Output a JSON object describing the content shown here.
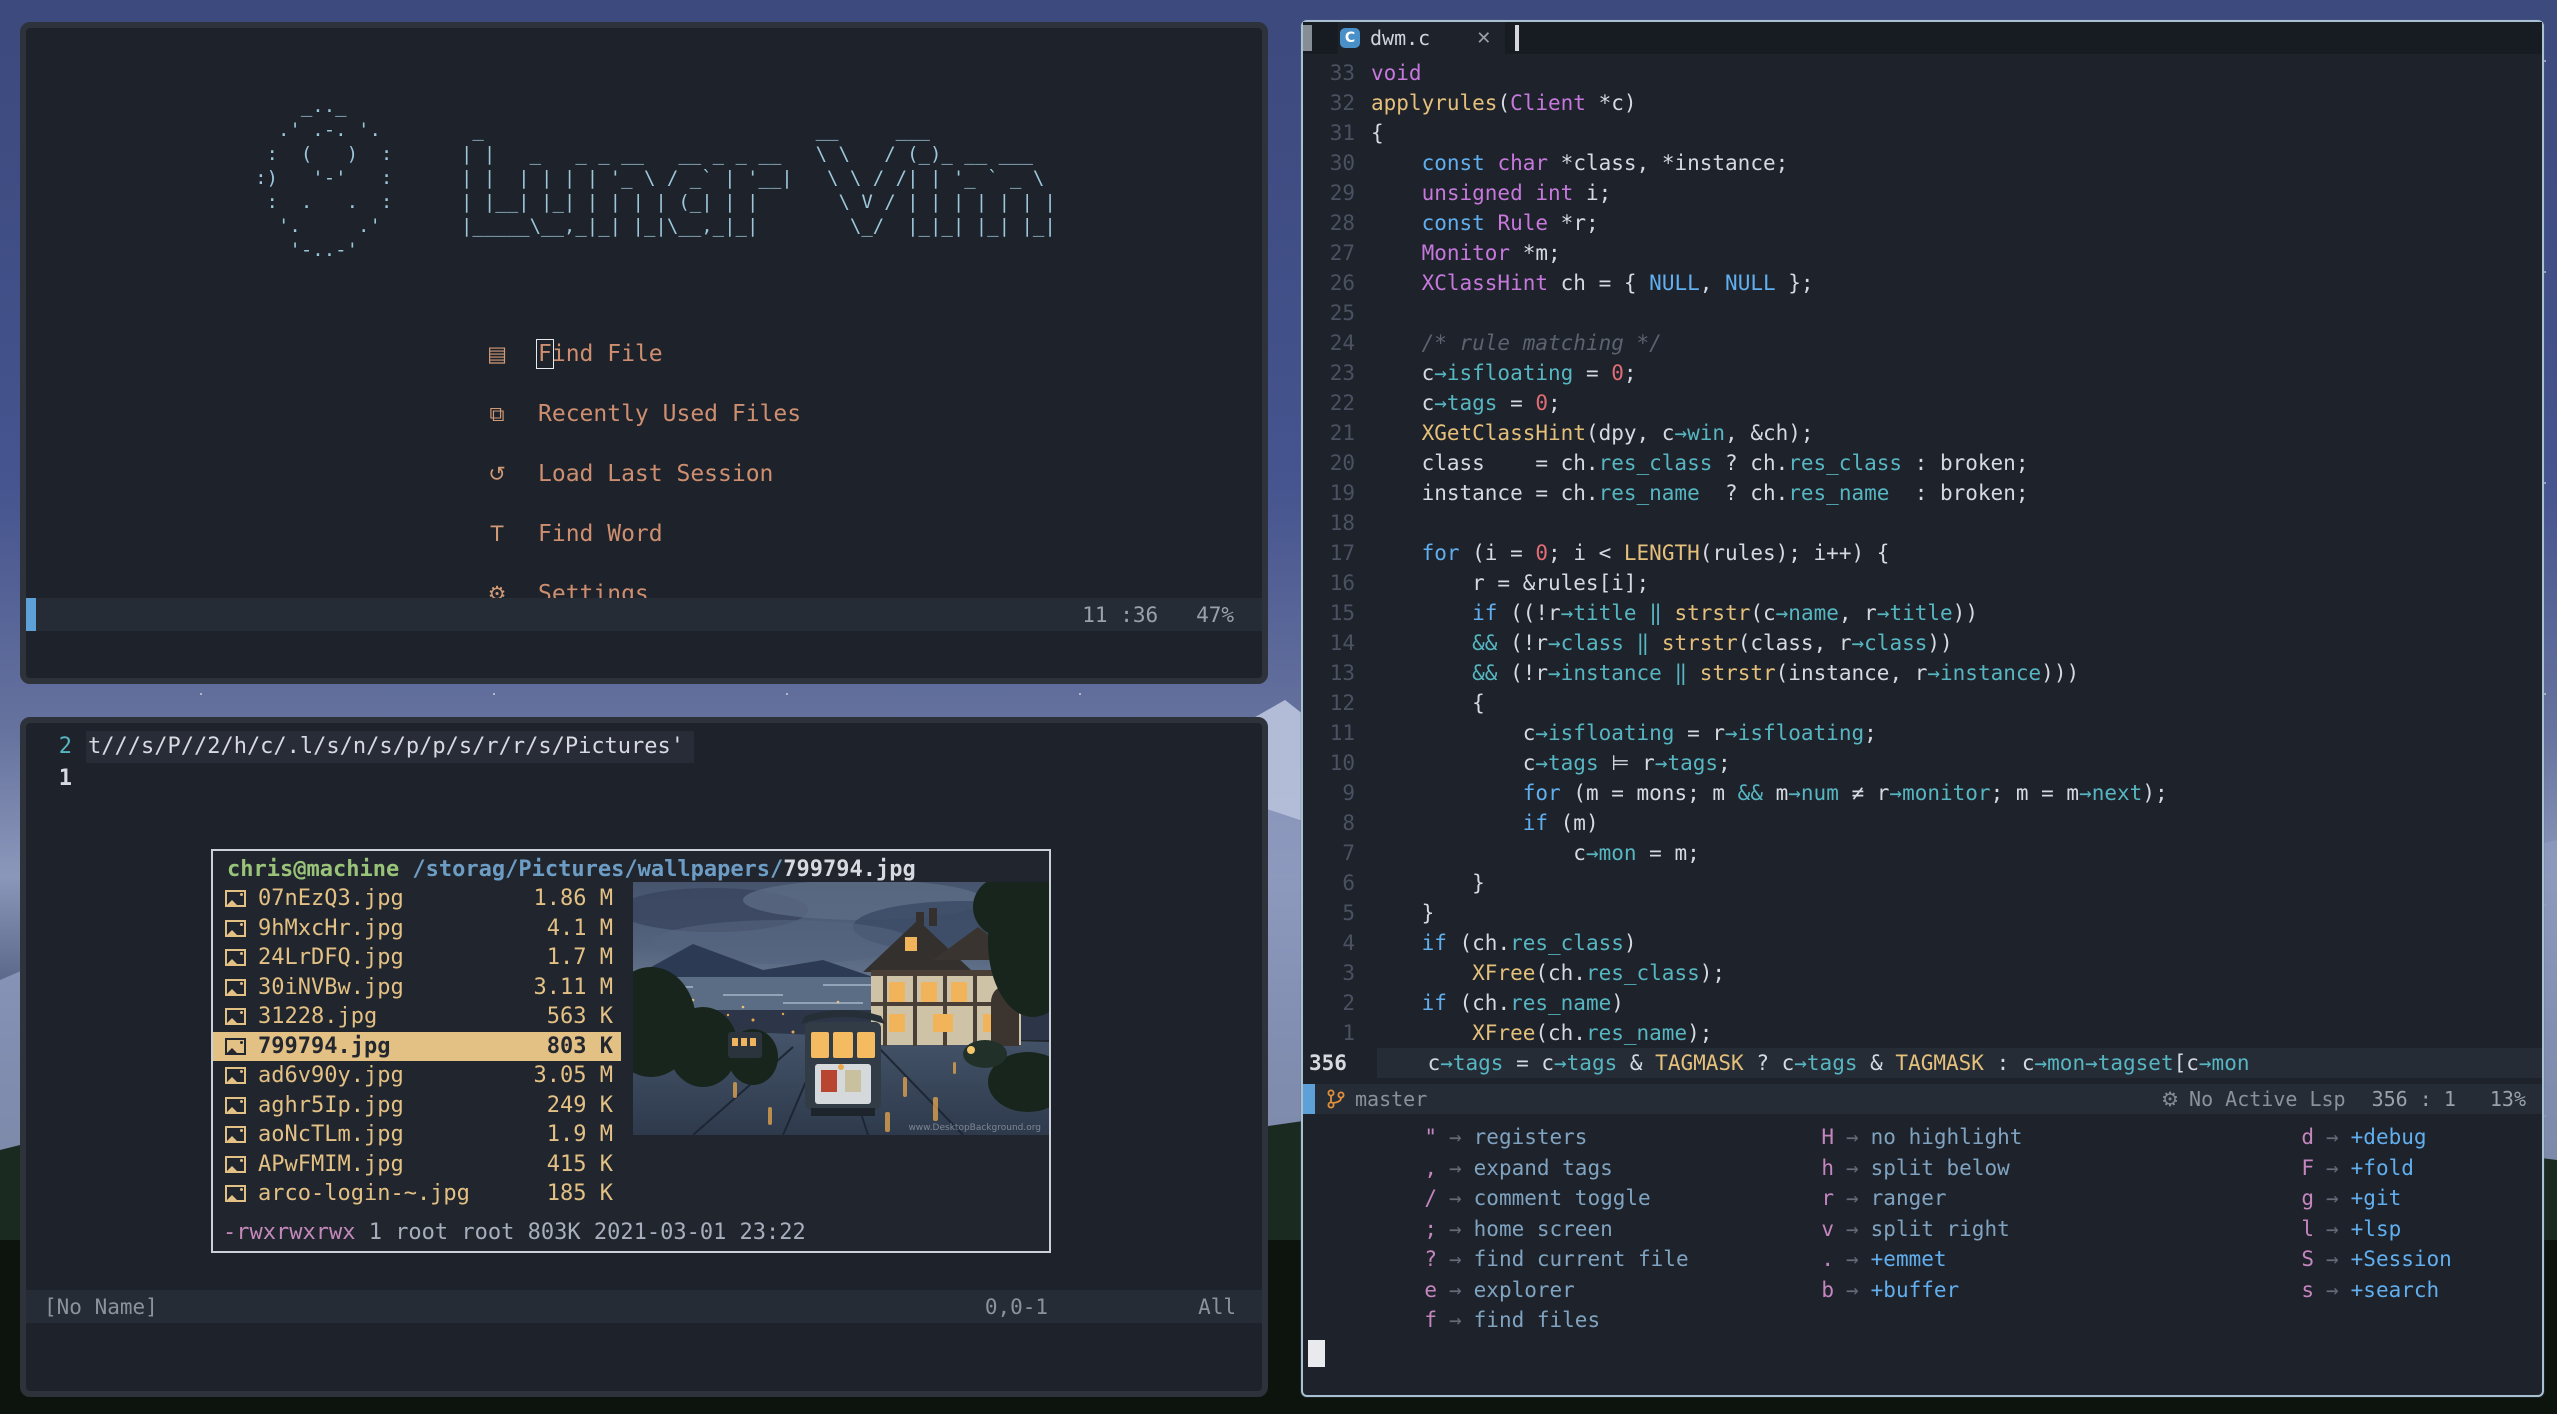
{
  "dashboard_window": {
    "logo_lines": [
      "      _.._",
      "    .' .-. '.        _                             __     ___",
      "   :  (   )  :      | |   _   _ _ __   __ _ _ __   \\ \\   / (_)_ __ ___",
      "  :)   '-'   :      | |  | | | | '_ \\ / _` | '__|   \\ \\ / /| | '_ ` _ \\",
      "   :  .   .  :      | |__| |_| | | | | (_| | |       \\ V / | | | | | | |",
      "    '.     .'       |_____\\__,_|_| |_|\\__,_|_|        \\_/  |_|_| |_| |_|",
      "     '-..-'"
    ],
    "menu": [
      {
        "icon": "▤",
        "icon_name": "file-icon",
        "label": "Find File",
        "cursor_on_first_char": true
      },
      {
        "icon": "⧉",
        "icon_name": "copies-icon",
        "label": "Recently Used Files"
      },
      {
        "icon": "↺",
        "icon_name": "restore-session-icon",
        "label": "Load Last Session"
      },
      {
        "icon": "T",
        "icon_name": "letter-t-icon",
        "label": "Find Word"
      },
      {
        "icon": "⚙",
        "icon_name": "gear-icon",
        "label": "Settings"
      }
    ],
    "statusline_right": "11 :36   47%"
  },
  "explorer_window": {
    "buffer_lines": [
      {
        "num": "2",
        "text": "t///s/P//2/h/c/.l/s/n/s/p/p/s/r/r/s/Pictures'",
        "current": false
      },
      {
        "num": "1",
        "text": "",
        "current": true
      }
    ],
    "popup": {
      "user": "chris@machine",
      "path": " /storag/Pictures/wallpapers/",
      "file": "799794.jpg",
      "files": [
        {
          "name": "07nEzQ3.jpg",
          "size": "1.86 M",
          "selected": false
        },
        {
          "name": "9hMxcHr.jpg",
          "size": "4.1 M",
          "selected": false
        },
        {
          "name": "24LrDFQ.jpg",
          "size": "1.7 M",
          "selected": false
        },
        {
          "name": "30iNVBw.jpg",
          "size": "3.11 M",
          "selected": false
        },
        {
          "name": "31228.jpg",
          "size": "563 K",
          "selected": false
        },
        {
          "name": "799794.jpg",
          "size": "803 K",
          "selected": true
        },
        {
          "name": "ad6v90y.jpg",
          "size": "3.05 M",
          "selected": false
        },
        {
          "name": "aghr5Ip.jpg",
          "size": "249 K",
          "selected": false
        },
        {
          "name": "aoNcTLm.jpg",
          "size": "1.9 M",
          "selected": false
        },
        {
          "name": "APwFMIM.jpg",
          "size": "415 K",
          "selected": false
        },
        {
          "name": "arco-login-~.jpg",
          "size": "185 K",
          "selected": false
        }
      ],
      "info_perm": "-rwxrwxrwx",
      "info_rest": " 1 root root 803K 2021-03-01 23:22",
      "watermark": "www.DesktopBackground.org"
    },
    "statusline": {
      "name": "[No Name]",
      "pos": "0,0-1",
      "scroll": "All"
    }
  },
  "editor_window": {
    "tab": {
      "title": "dwm.c",
      "close": "✕",
      "language_icon": "C"
    },
    "code_lines": [
      {
        "n": "33",
        "cur": false,
        "tokens": [
          [
            "kw",
            "void"
          ]
        ]
      },
      {
        "n": "32",
        "cur": false,
        "tokens": [
          [
            "fn",
            "applyrules"
          ],
          [
            "tx",
            "("
          ],
          [
            "kw",
            "Client"
          ],
          [
            "tx",
            " *c)"
          ]
        ]
      },
      {
        "n": "31",
        "cur": false,
        "tokens": [
          [
            "tx",
            "{"
          ]
        ]
      },
      {
        "n": "30",
        "cur": false,
        "tokens": [
          [
            "tx",
            "    "
          ],
          [
            "ctl",
            "const"
          ],
          [
            "tx",
            " "
          ],
          [
            "kw",
            "char"
          ],
          [
            "tx",
            " *class, *instance;"
          ]
        ]
      },
      {
        "n": "29",
        "cur": false,
        "tokens": [
          [
            "tx",
            "    "
          ],
          [
            "kw",
            "unsigned int"
          ],
          [
            "tx",
            " i;"
          ]
        ]
      },
      {
        "n": "28",
        "cur": false,
        "tokens": [
          [
            "tx",
            "    "
          ],
          [
            "ctl",
            "const"
          ],
          [
            "tx",
            " "
          ],
          [
            "kw",
            "Rule"
          ],
          [
            "tx",
            " *r;"
          ]
        ]
      },
      {
        "n": "27",
        "cur": false,
        "tokens": [
          [
            "tx",
            "    "
          ],
          [
            "kw",
            "Monitor"
          ],
          [
            "tx",
            " *m;"
          ]
        ]
      },
      {
        "n": "26",
        "cur": false,
        "tokens": [
          [
            "tx",
            "    "
          ],
          [
            "kw",
            "XClassHint"
          ],
          [
            "tx",
            " ch = { "
          ],
          [
            "ctl",
            "NULL"
          ],
          [
            "tx",
            ", "
          ],
          [
            "ctl",
            "NULL"
          ],
          [
            "tx",
            " };"
          ]
        ]
      },
      {
        "n": "25",
        "cur": false,
        "tokens": []
      },
      {
        "n": "24",
        "cur": false,
        "tokens": [
          [
            "tx",
            "    "
          ],
          [
            "cm",
            "/* rule matching */"
          ]
        ]
      },
      {
        "n": "23",
        "cur": false,
        "tokens": [
          [
            "tx",
            "    c"
          ],
          [
            "mem",
            "→isfloating"
          ],
          [
            "tx",
            " = "
          ],
          [
            "num",
            "0"
          ],
          [
            "tx",
            ";"
          ]
        ]
      },
      {
        "n": "22",
        "cur": false,
        "tokens": [
          [
            "tx",
            "    c"
          ],
          [
            "mem",
            "→tags"
          ],
          [
            "tx",
            " = "
          ],
          [
            "num",
            "0"
          ],
          [
            "tx",
            ";"
          ]
        ]
      },
      {
        "n": "21",
        "cur": false,
        "tokens": [
          [
            "tx",
            "    "
          ],
          [
            "fn",
            "XGetClassHint"
          ],
          [
            "tx",
            "(dpy, c"
          ],
          [
            "mem",
            "→win"
          ],
          [
            "tx",
            ", &ch);"
          ]
        ]
      },
      {
        "n": "20",
        "cur": false,
        "tokens": [
          [
            "tx",
            "    class    = ch."
          ],
          [
            "mem",
            "res_class"
          ],
          [
            "tx",
            " ? ch."
          ],
          [
            "mem",
            "res_class"
          ],
          [
            "tx",
            " : broken;"
          ]
        ]
      },
      {
        "n": "19",
        "cur": false,
        "tokens": [
          [
            "tx",
            "    instance = ch."
          ],
          [
            "mem",
            "res_name"
          ],
          [
            "tx",
            "  ? ch."
          ],
          [
            "mem",
            "res_name"
          ],
          [
            "tx",
            "  : broken;"
          ]
        ]
      },
      {
        "n": "18",
        "cur": false,
        "tokens": []
      },
      {
        "n": "17",
        "cur": false,
        "tokens": [
          [
            "tx",
            "    "
          ],
          [
            "ctl",
            "for"
          ],
          [
            "tx",
            " (i = "
          ],
          [
            "num",
            "0"
          ],
          [
            "tx",
            "; i < "
          ],
          [
            "fn",
            "LENGTH"
          ],
          [
            "tx",
            "(rules); i++) {"
          ]
        ]
      },
      {
        "n": "16",
        "cur": false,
        "tokens": [
          [
            "tx",
            "        r = &rules[i];"
          ]
        ]
      },
      {
        "n": "15",
        "cur": false,
        "tokens": [
          [
            "tx",
            "        "
          ],
          [
            "ctl",
            "if"
          ],
          [
            "tx",
            " ((!r"
          ],
          [
            "mem",
            "→title"
          ],
          [
            "tx",
            " "
          ],
          [
            "mem",
            "‖"
          ],
          [
            "tx",
            " "
          ],
          [
            "fn",
            "strstr"
          ],
          [
            "tx",
            "(c"
          ],
          [
            "mem",
            "→name"
          ],
          [
            "tx",
            ", r"
          ],
          [
            "mem",
            "→title"
          ],
          [
            "tx",
            "))"
          ]
        ]
      },
      {
        "n": "14",
        "cur": false,
        "tokens": [
          [
            "tx",
            "        "
          ],
          [
            "mem",
            "&&"
          ],
          [
            "tx",
            " (!r"
          ],
          [
            "mem",
            "→class"
          ],
          [
            "tx",
            " "
          ],
          [
            "mem",
            "‖"
          ],
          [
            "tx",
            " "
          ],
          [
            "fn",
            "strstr"
          ],
          [
            "tx",
            "(class, r"
          ],
          [
            "mem",
            "→class"
          ],
          [
            "tx",
            "))"
          ]
        ]
      },
      {
        "n": "13",
        "cur": false,
        "tokens": [
          [
            "tx",
            "        "
          ],
          [
            "mem",
            "&&"
          ],
          [
            "tx",
            " (!r"
          ],
          [
            "mem",
            "→instance"
          ],
          [
            "tx",
            " "
          ],
          [
            "mem",
            "‖"
          ],
          [
            "tx",
            " "
          ],
          [
            "fn",
            "strstr"
          ],
          [
            "tx",
            "(instance, r"
          ],
          [
            "mem",
            "→instance"
          ],
          [
            "tx",
            ")))"
          ]
        ]
      },
      {
        "n": "12",
        "cur": false,
        "tokens": [
          [
            "tx",
            "        {"
          ]
        ]
      },
      {
        "n": "11",
        "cur": false,
        "tokens": [
          [
            "tx",
            "            c"
          ],
          [
            "mem",
            "→isfloating"
          ],
          [
            "tx",
            " = r"
          ],
          [
            "mem",
            "→isfloating"
          ],
          [
            "tx",
            ";"
          ]
        ]
      },
      {
        "n": "10",
        "cur": false,
        "tokens": [
          [
            "tx",
            "            c"
          ],
          [
            "mem",
            "→tags"
          ],
          [
            "tx",
            " ⊨ r"
          ],
          [
            "mem",
            "→tags"
          ],
          [
            "tx",
            ";"
          ]
        ]
      },
      {
        "n": "9",
        "cur": false,
        "tokens": [
          [
            "tx",
            "            "
          ],
          [
            "ctl",
            "for"
          ],
          [
            "tx",
            " (m = mons; m "
          ],
          [
            "mem",
            "&&"
          ],
          [
            "tx",
            " m"
          ],
          [
            "mem",
            "→num"
          ],
          [
            "tx",
            " ≠ r"
          ],
          [
            "mem",
            "→monitor"
          ],
          [
            "tx",
            "; m = m"
          ],
          [
            "mem",
            "→next"
          ],
          [
            "tx",
            ");"
          ]
        ]
      },
      {
        "n": "8",
        "cur": false,
        "tokens": [
          [
            "tx",
            "            "
          ],
          [
            "ctl",
            "if"
          ],
          [
            "tx",
            " (m)"
          ]
        ]
      },
      {
        "n": "7",
        "cur": false,
        "tokens": [
          [
            "tx",
            "                c"
          ],
          [
            "mem",
            "→mon"
          ],
          [
            "tx",
            " = m;"
          ]
        ]
      },
      {
        "n": "6",
        "cur": false,
        "tokens": [
          [
            "tx",
            "        }"
          ]
        ]
      },
      {
        "n": "5",
        "cur": false,
        "tokens": [
          [
            "tx",
            "    }"
          ]
        ]
      },
      {
        "n": "4",
        "cur": false,
        "tokens": [
          [
            "tx",
            "    "
          ],
          [
            "ctl",
            "if"
          ],
          [
            "tx",
            " (ch."
          ],
          [
            "mem",
            "res_class"
          ],
          [
            "tx",
            ")"
          ]
        ]
      },
      {
        "n": "3",
        "cur": false,
        "tokens": [
          [
            "tx",
            "        "
          ],
          [
            "fn",
            "XFree"
          ],
          [
            "tx",
            "(ch."
          ],
          [
            "mem",
            "res_class"
          ],
          [
            "tx",
            ");"
          ]
        ]
      },
      {
        "n": "2",
        "cur": false,
        "tokens": [
          [
            "tx",
            "    "
          ],
          [
            "ctl",
            "if"
          ],
          [
            "tx",
            " (ch."
          ],
          [
            "mem",
            "res_name"
          ],
          [
            "tx",
            ")"
          ]
        ]
      },
      {
        "n": "1",
        "cur": false,
        "tokens": [
          [
            "tx",
            "        "
          ],
          [
            "fn",
            "XFree"
          ],
          [
            "tx",
            "(ch."
          ],
          [
            "mem",
            "res_name"
          ],
          [
            "tx",
            ");"
          ]
        ]
      },
      {
        "n": "356",
        "cur": true,
        "tokens": [
          [
            "tx",
            "    c"
          ],
          [
            "mem",
            "→tags"
          ],
          [
            "tx",
            " = c"
          ],
          [
            "mem",
            "→tags"
          ],
          [
            "tx",
            " & "
          ],
          [
            "fn",
            "TAGMASK"
          ],
          [
            "tx",
            " ? c"
          ],
          [
            "mem",
            "→tags"
          ],
          [
            "tx",
            " & "
          ],
          [
            "fn",
            "TAGMASK"
          ],
          [
            "tx",
            " : c"
          ],
          [
            "mem",
            "→mon"
          ],
          [
            "mem",
            "→tagset"
          ],
          [
            "tx",
            "[c"
          ],
          [
            "mem",
            "→mon"
          ]
        ]
      }
    ],
    "statusline": {
      "branch": "master",
      "lsp": "No Active Lsp",
      "position": "356 : 1",
      "percent": "13%",
      "gear_icon": "⚙"
    },
    "whichkey": {
      "arrow": "→",
      "columns": [
        [
          {
            "key": "\"",
            "label": "registers"
          },
          {
            "key": ",",
            "label": "expand tags"
          },
          {
            "key": "/",
            "label": "comment toggle"
          },
          {
            "key": ";",
            "label": "home screen"
          },
          {
            "key": "?",
            "label": "find current file"
          },
          {
            "key": "e",
            "label": "explorer"
          },
          {
            "key": "f",
            "label": "find files"
          }
        ],
        [
          {
            "key": "H",
            "label": "no highlight"
          },
          {
            "key": "h",
            "label": "split below"
          },
          {
            "key": "r",
            "label": "ranger"
          },
          {
            "key": "v",
            "label": "split right"
          },
          {
            "key": ".",
            "label": "+emmet",
            "group": true
          },
          {
            "key": "b",
            "label": "+buffer",
            "group": true
          }
        ],
        [
          {
            "key": "d",
            "label": "+debug",
            "group": true
          },
          {
            "key": "F",
            "label": "+fold",
            "group": true
          },
          {
            "key": "g",
            "label": "+git",
            "group": true
          },
          {
            "key": "l",
            "label": "+lsp",
            "group": true
          },
          {
            "key": "S",
            "label": "+Session",
            "group": true
          },
          {
            "key": "s",
            "label": "+search",
            "group": true
          }
        ]
      ]
    }
  }
}
